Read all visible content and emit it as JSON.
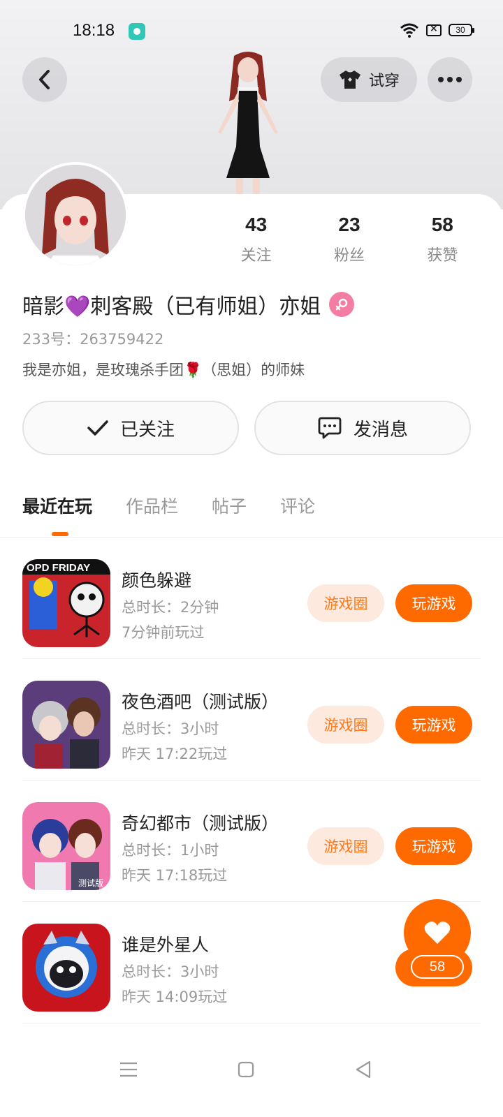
{
  "status_bar": {
    "time": "18:18",
    "battery": "30",
    "icons": [
      "app-notification-icon",
      "wifi-icon",
      "no-sim-icon",
      "battery-icon"
    ]
  },
  "header": {
    "back_icon": "chevron-left-icon",
    "tryon_label": "试穿",
    "tryon_icon": "tshirt-icon",
    "more_icon": "ellipsis-icon"
  },
  "profile": {
    "name": "暗影💜刺客殿（已有师姐）亦姐",
    "gender_icon": "female-icon",
    "id_text": "233号：263759422",
    "bio": "我是亦姐，是玫瑰杀手团🌹（思姐）的师妹",
    "stats": [
      {
        "value": "43",
        "label": "关注"
      },
      {
        "value": "23",
        "label": "粉丝"
      },
      {
        "value": "58",
        "label": "获赞"
      }
    ]
  },
  "actions": {
    "follow_label": "已关注",
    "message_label": "发消息"
  },
  "tabs": [
    {
      "label": "最近在玩",
      "active": true
    },
    {
      "label": "作品栏",
      "active": false
    },
    {
      "label": "帖子",
      "active": false
    },
    {
      "label": "评论",
      "active": false
    }
  ],
  "games": [
    {
      "title": "颜色躲避",
      "duration": "总时长：2分钟",
      "last_played": "7分钟前玩过",
      "circle_label": "游戏圈",
      "play_label": "玩游戏"
    },
    {
      "title": "夜色酒吧（测试版）",
      "duration": "总时长：3小时",
      "last_played": "昨天 17:22玩过",
      "circle_label": "游戏圈",
      "play_label": "玩游戏"
    },
    {
      "title": "奇幻都市（测试版）",
      "duration": "总时长：1小时",
      "last_played": "昨天 17:18玩过",
      "circle_label": "游戏圈",
      "play_label": "玩游戏"
    },
    {
      "title": "谁是外星人",
      "duration": "总时长：3小时",
      "last_played": "昨天 14:09玩过",
      "circle_label": "",
      "play_label": ""
    }
  ],
  "game_icon_texts": [
    "OPD FRIDAY",
    "测试版"
  ],
  "like": {
    "count": "58"
  },
  "colors": {
    "accent": "#ff6a00",
    "accent_light": "#fde9de",
    "gender": "#f47ea3"
  }
}
